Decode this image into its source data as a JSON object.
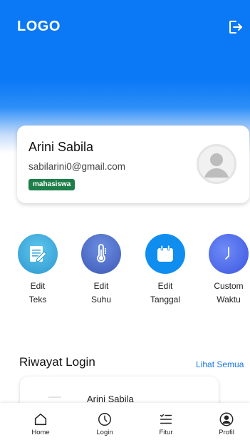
{
  "header": {
    "logo": "LOGO",
    "logout_icon": "logout-icon",
    "background_color": "#0b78f5"
  },
  "profile": {
    "name": "Arini Sabila",
    "email": "sabilarini0@gmail.com",
    "role": "mahasiswa",
    "avatar_icon": "user-avatar-icon",
    "badge_color": "#1e7e4a"
  },
  "features": [
    {
      "label_line1": "Edit",
      "label_line2": "Teks",
      "icon": "edit-text-icon",
      "color": "#3aa8d8"
    },
    {
      "label_line1": "Edit",
      "label_line2": "Suhu",
      "icon": "thermometer-icon",
      "color": "#4d6fc8"
    },
    {
      "label_line1": "Edit",
      "label_line2": "Tanggal",
      "icon": "calendar-icon",
      "color": "#0f8ef0"
    },
    {
      "label_line1": "Custom",
      "label_line2": "Waktu",
      "icon": "clock-icon",
      "color": "#4a6ef0"
    }
  ],
  "login_history": {
    "title": "Riwayat Login",
    "see_all": "Lihat Semua",
    "items": [
      {
        "name": "Arini Sabila"
      }
    ]
  },
  "bottom_nav": [
    {
      "label": "Home",
      "icon": "home-icon"
    },
    {
      "label": "Login",
      "icon": "history-clock-icon"
    },
    {
      "label": "Fitur",
      "icon": "list-icon"
    },
    {
      "label": "Profil",
      "icon": "profile-icon"
    }
  ],
  "colors": {
    "accent": "#0b78f5",
    "link": "#1677e8"
  }
}
